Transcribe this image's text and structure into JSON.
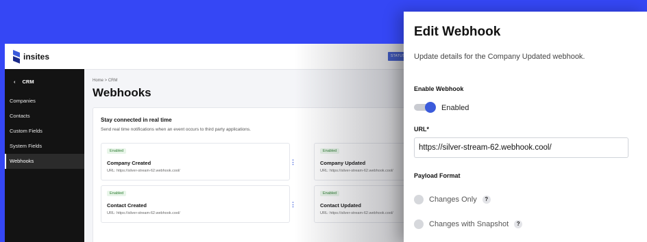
{
  "app": {
    "logo_text": "insites",
    "status_button": "STATUS"
  },
  "sidebar": {
    "back_label": "CRM",
    "items": [
      {
        "label": "Companies"
      },
      {
        "label": "Contacts"
      },
      {
        "label": "Custom Fields"
      },
      {
        "label": "System Fields"
      },
      {
        "label": "Webhooks"
      }
    ]
  },
  "main": {
    "breadcrumb": "Home  >  CRM",
    "title": "Webhooks",
    "panel_title": "Stay connected in real time",
    "panel_subtitle": "Send real time notifications when an event occurs to third party applications.",
    "cards": [
      {
        "badge": "Enabled",
        "title": "Company Created",
        "url": "URL: https://silver-stream-62.webhook.cool/"
      },
      {
        "badge": "Enabled",
        "title": "Company Updated",
        "url": "URL: https://silver-stream-62.webhook.cool/"
      },
      {
        "badge": "Enabled",
        "title": "Contact Created",
        "url": "URL: https://silver-stream-62.webhook.cool/"
      },
      {
        "badge": "Enabled",
        "title": "Contact Updated",
        "url": "URL: https://silver-stream-62.webhook.cool/"
      }
    ]
  },
  "drawer": {
    "title": "Edit Webhook",
    "subtitle": "Update details for the Company Updated webhook.",
    "enable_label": "Enable Webhook",
    "toggle_state": "Enabled",
    "url_label": "URL*",
    "url_value": "https://silver-stream-62.webhook.cool/",
    "payload_label": "Payload Format",
    "payload_options": [
      {
        "label": "Changes Only",
        "help": "?"
      },
      {
        "label": "Changes with Snapshot",
        "help": "?"
      }
    ]
  },
  "colors": {
    "background": "#3547f5",
    "accent": "#3b5bdb",
    "sidebar": "#131313"
  }
}
